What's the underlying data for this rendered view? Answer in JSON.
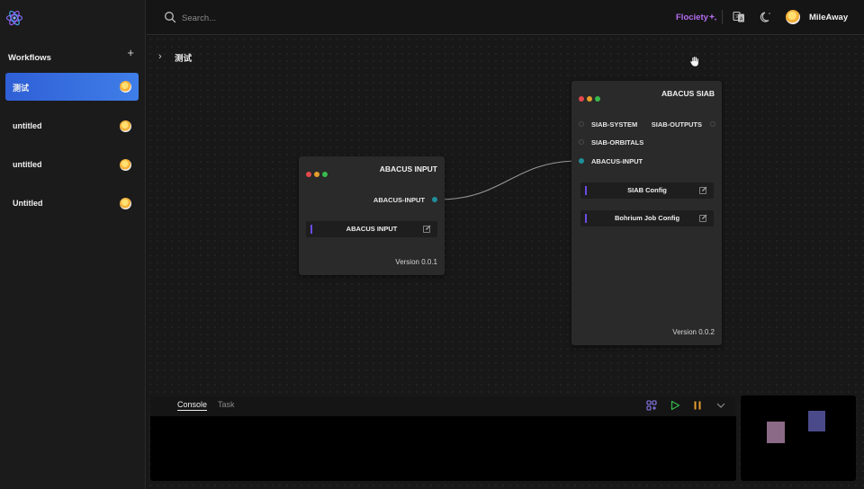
{
  "sidebar": {
    "title": "Workflows",
    "add_label": "+",
    "items": [
      {
        "label": "测试",
        "active": true
      },
      {
        "label": "untitled",
        "active": false
      },
      {
        "label": "untitled",
        "active": false
      },
      {
        "label": "Untitled",
        "active": false
      }
    ]
  },
  "topbar": {
    "search_placeholder": "Search...",
    "brand_link": "Flociety",
    "user_name": "MileAway"
  },
  "canvas": {
    "breadcrumb": "测试"
  },
  "nodes": {
    "abacus_input": {
      "title": "ABACUS INPUT",
      "output_port": "ABACUS-INPUT",
      "config_label": "ABACUS INPUT",
      "version": "Version 0.0.1"
    },
    "abacus_siab": {
      "title": "ABACUS SIAB",
      "input_ports": [
        "SIAB-SYSTEM",
        "SIAB-ORBITALS",
        "ABACUS-INPUT"
      ],
      "output_port": "SIAB-OUTPUTS",
      "configs": [
        "SIAB Config",
        "Bohrium Job Config"
      ],
      "version": "Version 0.0.2"
    }
  },
  "console": {
    "tabs": [
      "Console",
      "Task"
    ]
  },
  "colors": {
    "accent_blue": "#3f7ee8",
    "brand_purple": "#b46cf0",
    "port_teal": "#1f8f9a",
    "run_green": "#38b94d",
    "pause_orange": "#e59e2d"
  }
}
